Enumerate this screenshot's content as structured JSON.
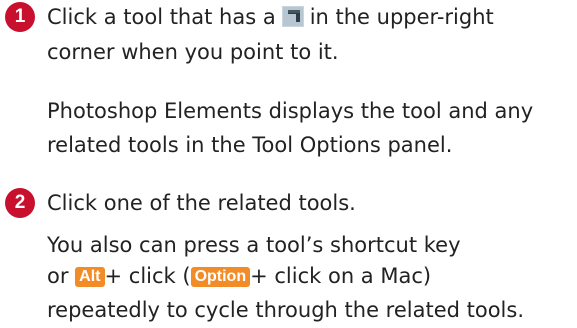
{
  "steps": [
    {
      "number": "1",
      "line1_before_icon": "Click a tool that has a",
      "line1_after_icon": "in the upper-right",
      "line2": "corner when you point to it.",
      "result_line1": "Photoshop Elements displays the tool and any",
      "result_line2": "related tools in the Tool Options panel."
    },
    {
      "number": "2",
      "line1": "Click one of the related tools.",
      "result_line1": "You also can press a tool’s shortcut key",
      "result_line2": {
        "or": "or",
        "key_alt": "Alt",
        "plus_click": "+ click (",
        "key_option": "Option",
        "plus_click_mac": "+ click on a Mac)"
      },
      "result_line3": "repeatedly to cycle through the related tools."
    }
  ],
  "icons": {
    "corner_icon": "tool-corner-triangle-icon"
  },
  "colors": {
    "step_badge": "#c8102e",
    "key_badge": "#f28c28",
    "text": "#222222"
  }
}
